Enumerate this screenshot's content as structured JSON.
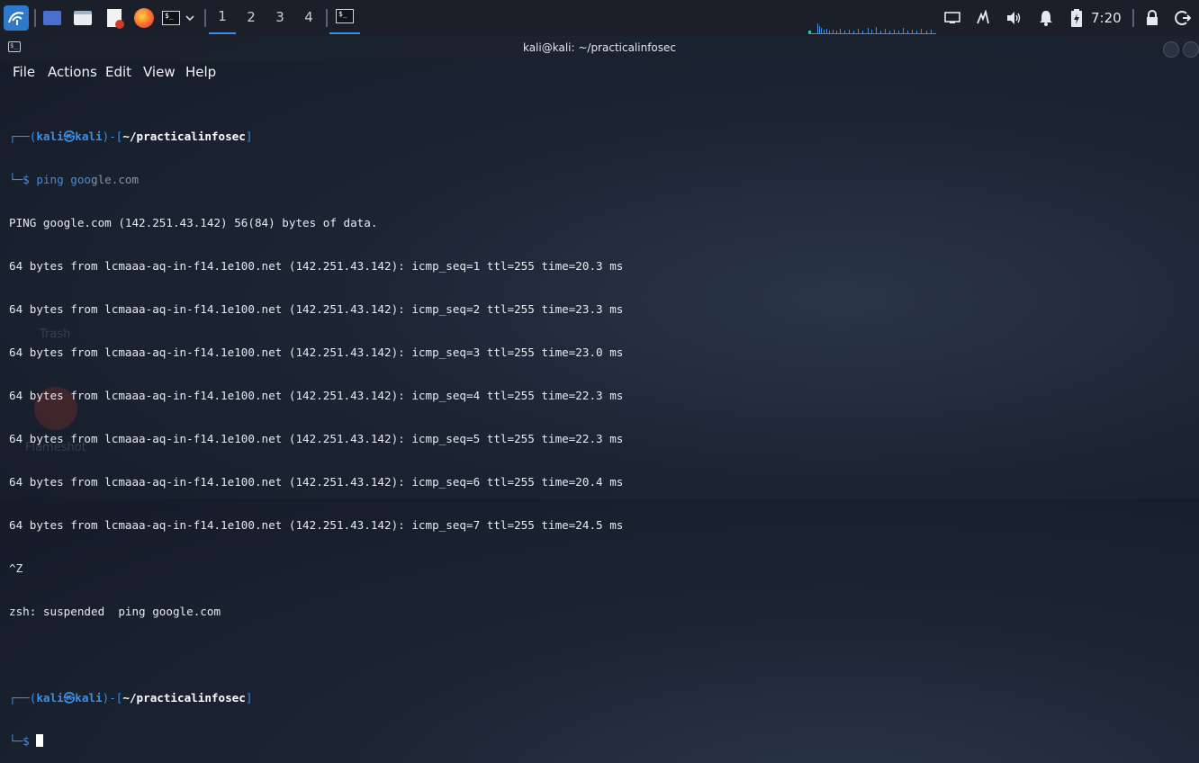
{
  "taskbar": {
    "workspaces": [
      "1",
      "2",
      "3",
      "4"
    ],
    "active_workspace": "1",
    "clock": "7:20",
    "icons": [
      "kali-menu-icon",
      "desktop-icon",
      "file-manager-icon",
      "text-editor-icon",
      "firefox-icon",
      "terminal-icon",
      "chevron-down-icon",
      "terminal-task-icon",
      "network-icon",
      "power-manager-icon",
      "volume-icon",
      "notifications-icon",
      "battery-icon",
      "lock-icon",
      "logout-icon"
    ]
  },
  "window": {
    "title": "kali@kali: ~/practicalinfosec"
  },
  "menu": {
    "file": "File",
    "actions": "Actions",
    "edit": "Edit",
    "view": "View",
    "help": "Help"
  },
  "terminal": {
    "prompt1": {
      "open": "┌──(",
      "user": "kali㉿kali",
      "mid": ")-[",
      "path": "~/practicalinfosec",
      "close": "]",
      "prefix": "└─$ ",
      "command": "ping goo",
      "suggestion": "gle.com"
    },
    "output": [
      "PING google.com (142.251.43.142) 56(84) bytes of data.",
      "64 bytes from lcmaaa-aq-in-f14.1e100.net (142.251.43.142): icmp_seq=1 ttl=255 time=20.3 ms",
      "64 bytes from lcmaaa-aq-in-f14.1e100.net (142.251.43.142): icmp_seq=2 ttl=255 time=23.3 ms",
      "64 bytes from lcmaaa-aq-in-f14.1e100.net (142.251.43.142): icmp_seq=3 ttl=255 time=23.0 ms",
      "64 bytes from lcmaaa-aq-in-f14.1e100.net (142.251.43.142): icmp_seq=4 ttl=255 time=22.3 ms",
      "64 bytes from lcmaaa-aq-in-f14.1e100.net (142.251.43.142): icmp_seq=5 ttl=255 time=22.3 ms",
      "64 bytes from lcmaaa-aq-in-f14.1e100.net (142.251.43.142): icmp_seq=6 ttl=255 time=20.4 ms",
      "64 bytes from lcmaaa-aq-in-f14.1e100.net (142.251.43.142): icmp_seq=7 ttl=255 time=24.5 ms",
      "^Z",
      "zsh: suspended  ping google.com"
    ],
    "prompt2": {
      "open": "┌──(",
      "user": "kali㉿kali",
      "mid": ")-[",
      "path": "~/practicalinfosec",
      "close": "]",
      "prefix": "└─$ "
    }
  },
  "desktop": {
    "trash_label": "Trash",
    "flameshot_label": "Flameshot"
  },
  "colors": {
    "accent": "#3b8fe6",
    "taskbar_bg": "#1a1f29",
    "text": "#e8eaee"
  }
}
